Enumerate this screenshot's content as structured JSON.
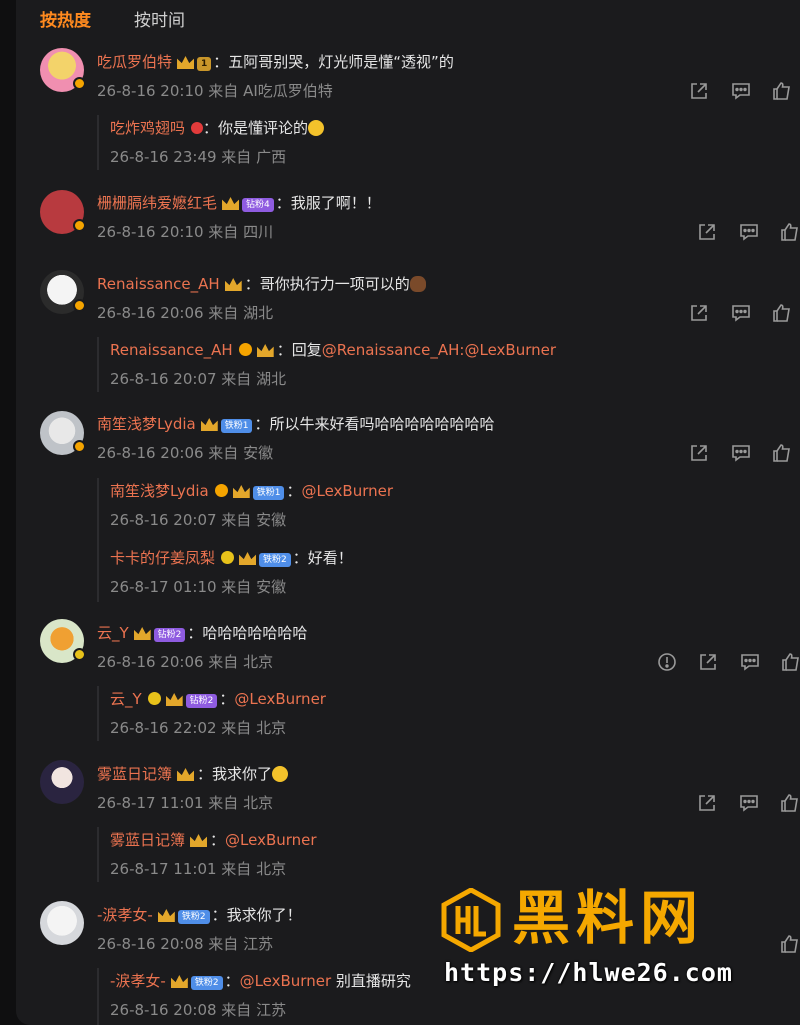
{
  "tabs": {
    "hot": "按热度",
    "time": "按时间"
  },
  "comments": [
    {
      "user": "吃瓜罗伯特",
      "badge": "1",
      "text": "：五阿哥别哭，灯光师是懂“透视”的",
      "meta": "26-8-16 20:10 来自 AI吃瓜罗伯特",
      "replies": [
        {
          "user": "吃炸鸡翅吗",
          "text": "：你是懂评论的",
          "meta": "26-8-16 23:49 来自 广西"
        }
      ]
    },
    {
      "user": "栅栅膈纬爱嬷红毛",
      "badge": "钻粉4",
      "text": "：我服了啊！！",
      "meta": "26-8-16 20:10 来自 四川",
      "replies": []
    },
    {
      "user": "Renaissance_AH",
      "text": "：哥你执行力一项可以的",
      "meta": "26-8-16 20:06 来自 湖北",
      "replies": [
        {
          "user": "Renaissance_AH",
          "text": "：回复",
          "mention1": "@Renaissance_AH",
          "mention2": ":@LexBurner",
          "meta": "26-8-16 20:07 来自 湖北"
        }
      ]
    },
    {
      "user": "南笙浅梦Lydia",
      "badge": "铁粉1",
      "text": "：所以牛来好看吗哈哈哈哈哈哈哈哈",
      "meta": "26-8-16 20:06 来自 安徽",
      "replies": [
        {
          "user": "南笙浅梦Lydia",
          "badge": "铁粉1",
          "mention": "@LexBurner",
          "meta": "26-8-16 20:07 来自 安徽"
        },
        {
          "user": "卡卡的仔姜凤梨",
          "badge": "铁粉2",
          "text": "：好看！",
          "meta": "26-8-17 01:10 来自 安徽"
        }
      ]
    },
    {
      "user": "云_Y",
      "badge": "钻粉2",
      "text": "：哈哈哈哈哈哈哈",
      "meta": "26-8-16 20:06 来自 北京",
      "replies": [
        {
          "user": "云_Y",
          "badge": "钻粉2",
          "mention": "@LexBurner",
          "meta": "26-8-16 22:02 来自 北京"
        }
      ]
    },
    {
      "user": "雾蓝日记簿",
      "text": "：我求你了",
      "meta": "26-8-17 11:01 来自 北京",
      "replies": [
        {
          "user": "雾蓝日记簿",
          "mention": "@LexBurner",
          "meta": "26-8-17 11:01 来自 北京"
        }
      ]
    },
    {
      "user": "-涙孝女-",
      "badge": "铁粉2",
      "text": "：我求你了！",
      "meta": "26-8-16 20:08 来自 江苏",
      "replies": [
        {
          "user": "-涙孝女-",
          "badge": "铁粉2",
          "mention": "@LexBurner",
          "tail": " 别直播研究",
          "meta": "26-8-16 20:08 来自 江苏"
        }
      ]
    }
  ],
  "watermark": {
    "title": "黑料网",
    "url": "https://hlwe26.com"
  },
  "colors": {
    "background": "#1b1b1d",
    "username": "#eb7350",
    "activeTab": "#ff8a1f",
    "meta": "#8a8a8a"
  },
  "icons": [
    "share-icon",
    "comment-icon",
    "like-icon",
    "report-icon"
  ]
}
